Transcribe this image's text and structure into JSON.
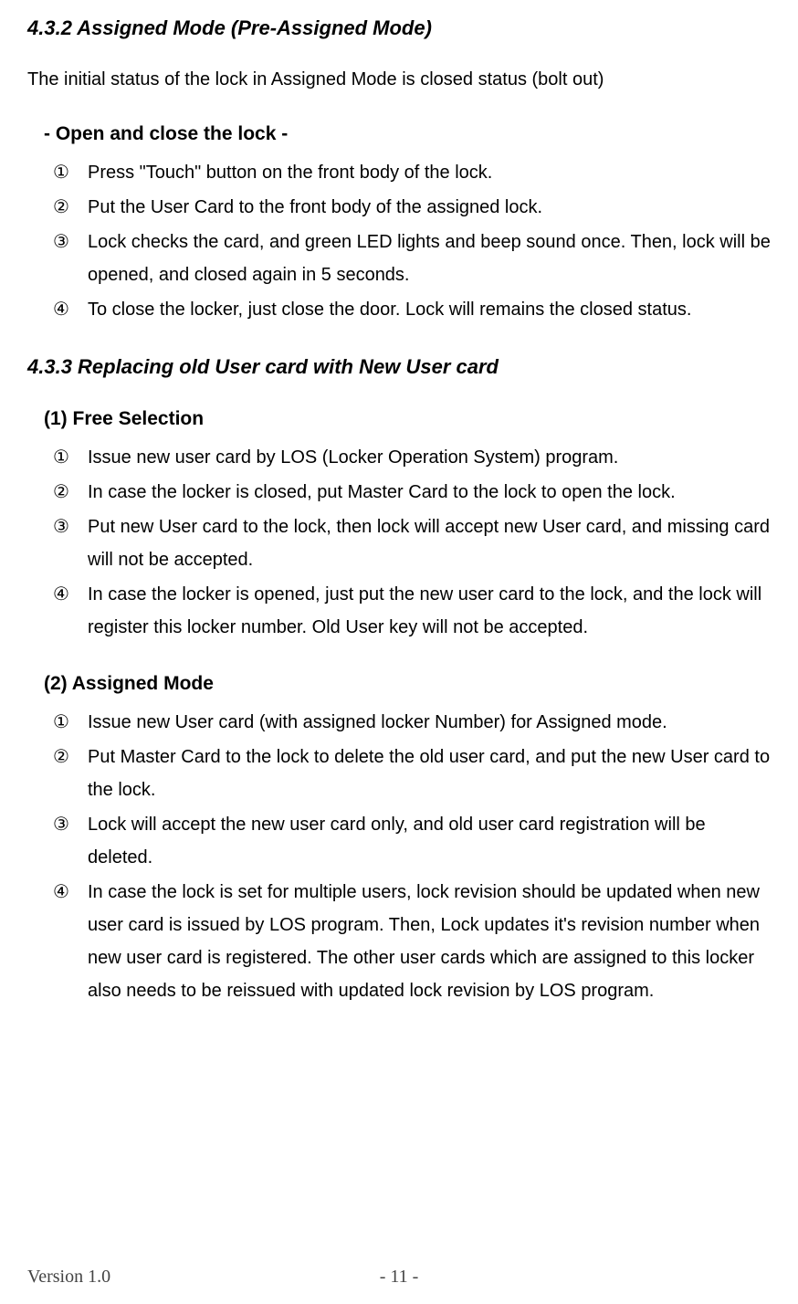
{
  "section_432": {
    "heading": "4.3.2    Assigned Mode (Pre-Assigned Mode)",
    "intro": "The initial status of the lock in Assigned Mode is closed status (bolt out)",
    "open_close": {
      "title": "- Open and close the lock -",
      "items": [
        "Press \"Touch\" button on the front body of the lock.",
        "Put the User Card to the front body of the assigned lock.",
        "Lock checks the card, and green LED lights and beep sound once. Then, lock will be opened, and closed again in 5 seconds.",
        "To close the locker, just close the door. Lock will remains the closed status."
      ]
    }
  },
  "section_433": {
    "heading": "4.3.3    Replacing old User card with New User card",
    "free_selection": {
      "title": "(1) Free Selection",
      "items": [
        "Issue new user card by LOS (Locker Operation System) program.",
        "In case the locker is closed, put Master Card to the lock to open the lock.",
        "Put new User card to the lock, then lock will accept new User card, and missing card will not be accepted.",
        "In case the locker is opened, just put the new user card to the lock, and the lock will register this locker number. Old User key will not be accepted."
      ]
    },
    "assigned_mode": {
      "title": "(2) Assigned Mode",
      "items": [
        "Issue new User card (with assigned locker Number) for Assigned mode.",
        "Put Master Card to the lock to delete the old user card, and put the new User card to the lock.",
        "Lock will accept the new user card only, and old user card registration will be deleted.",
        "In case the lock is set for multiple users, lock revision should be updated when new user card is issued by LOS program. Then, Lock updates it's revision number when new user card is registered. The other user cards which are assigned to this locker also needs to be reissued with updated lock revision by LOS program."
      ]
    }
  },
  "markers": [
    "①",
    "②",
    "③",
    "④"
  ],
  "footer": {
    "version": "Version 1.0",
    "page": "- 11 -"
  }
}
